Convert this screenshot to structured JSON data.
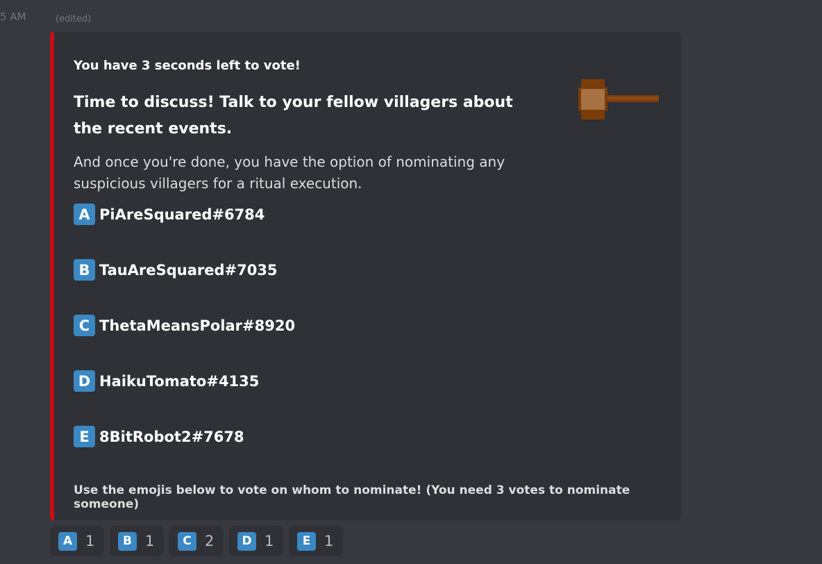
{
  "message": {
    "timestamp": "5 AM",
    "edited": "(edited)"
  },
  "embed": {
    "accent_color": "#c40f14",
    "vote_timer": "You have 3 seconds left to vote!",
    "title": "Time to discuss! Talk to your fellow villagers about the recent events.",
    "description": "And once you're done, you have the option of nominating any suspicious villagers for a ritual execution.",
    "thumbnail_icon": "gavel-icon",
    "nominees": [
      {
        "letter": "A",
        "name": "PiAreSquared#6784"
      },
      {
        "letter": "B",
        "name": "TauAreSquared#7035"
      },
      {
        "letter": "C",
        "name": "ThetaMeansPolar#8920"
      },
      {
        "letter": "D",
        "name": "HaikuTomato#4135"
      },
      {
        "letter": "E",
        "name": "8BitRobot2#7678"
      }
    ],
    "footer": "Use the emojis below to vote on whom to nominate! (You need 3 votes to nominate someone)"
  },
  "reactions": [
    {
      "letter": "A",
      "count": "1"
    },
    {
      "letter": "B",
      "count": "1"
    },
    {
      "letter": "C",
      "count": "2"
    },
    {
      "letter": "D",
      "count": "1"
    },
    {
      "letter": "E",
      "count": "1"
    }
  ]
}
